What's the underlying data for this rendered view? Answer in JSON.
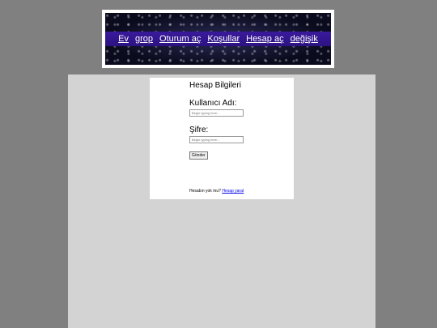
{
  "nav": {
    "items": [
      "Ev",
      "grop",
      "Oturum aç",
      "Koşullar",
      "Hesap aç",
      "değişik"
    ]
  },
  "login": {
    "title": "Hesap Bilgileri",
    "username_label": "Kullanıcı Adı:",
    "username_placeholder": "Begin typing here...",
    "password_label": "Şifre:",
    "password_placeholder": "Begin typing here...",
    "submit_label": "Gönder",
    "no_account_text": "Hesabın yok mu?",
    "create_account_link": "Hesap yarat"
  }
}
